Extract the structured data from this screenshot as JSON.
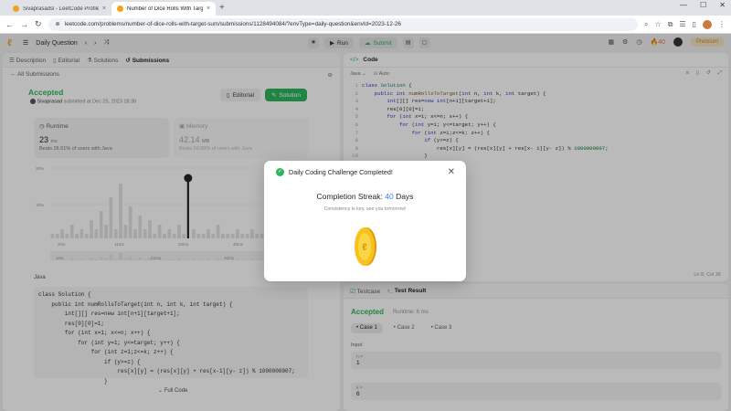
{
  "browser": {
    "tabs": [
      {
        "title": "Sivaprasadsl - LeetCode Profile",
        "active": false
      },
      {
        "title": "Number of Dice Rolls With Target",
        "active": true
      }
    ],
    "url": "leetcode.com/problems/number-of-dice-rolls-with-target-sum/submissions/1128494084/?envType=daily-question&envId=2023-12-26"
  },
  "nav": {
    "daily_question": "Daily Question",
    "run": "Run",
    "submit": "Submit",
    "streak_count": "40",
    "premium": "Premium"
  },
  "left": {
    "tabs": [
      "Description",
      "Editorial",
      "Solutions",
      "Submissions"
    ],
    "all_submissions": "All Submissions",
    "status": "Accepted",
    "author": "Sivaprasad",
    "submitted_at": "submitted at Dec 25, 2023 18:38",
    "editorial_btn": "Editorial",
    "solution_btn": "Solution",
    "runtime_label": "Runtime",
    "runtime_value": "23",
    "runtime_unit": "ms",
    "runtime_beats": "Beats 26.51% of users with Java",
    "memory_label": "Memory",
    "memory_value": "42.14",
    "memory_unit": "MB",
    "memory_beats": "Beats 50.89% of users with Java",
    "lang": "Java",
    "full_code": "Full Code",
    "code": "class Solution {\n    public int numRollsToTarget(int n, int k, int target) {\n        int[][] res=new int[n+1][target+1];\n        res[0][0]=1;\n        for (int x=1; x<=n; x++) {\n            for (int y=1; y<=target; y++) {\n                for (int z=1;z<=k; z++) {\n                    if (y>=z) {\n                        res[x][y] = (res[x][y] + res[x-1][y- z]) % 1000000007;\n                    }"
  },
  "chart_data": {
    "type": "bar",
    "y_ticks": [
      "20%",
      "10%"
    ],
    "x_ticks": [
      "2ms",
      "11ms",
      "22ms",
      "40ms",
      "74ms"
    ],
    "x_ticks_lower": [
      "2ms",
      "22ms",
      "40ms",
      "74ms"
    ],
    "values": [
      1,
      1,
      2,
      1,
      3,
      1,
      2,
      1,
      4,
      2,
      6,
      3,
      9,
      2,
      12,
      3,
      7,
      2,
      5,
      2,
      4,
      1,
      3,
      1,
      2,
      1,
      3,
      1,
      1,
      2,
      1,
      1,
      2,
      1,
      3,
      1,
      1,
      1,
      2,
      1,
      1,
      2,
      1,
      1,
      1,
      1,
      2,
      1,
      1,
      1,
      1,
      1
    ],
    "highlight_index": 28
  },
  "right": {
    "code_tab": "Code",
    "lang": "Java",
    "mode": "Auto",
    "line_col": "Ln 8, Col 26",
    "testcase_tab": "Testcase",
    "result_tab": "Test Result",
    "result_status": "Accepted",
    "result_runtime": "Runtime: 6 ms",
    "cases": [
      "Case 1",
      "Case 2",
      "Case 3"
    ],
    "input_label": "Input",
    "inputs": [
      {
        "var": "n =",
        "value": "1"
      },
      {
        "var": "k =",
        "value": "6"
      }
    ]
  },
  "modal": {
    "title": "Daily Coding Challenge Completed!",
    "streak_label": "Completion Streak:",
    "streak_value": "40",
    "streak_unit": "Days",
    "message": "Consistency is key, see you tomorrow!"
  }
}
